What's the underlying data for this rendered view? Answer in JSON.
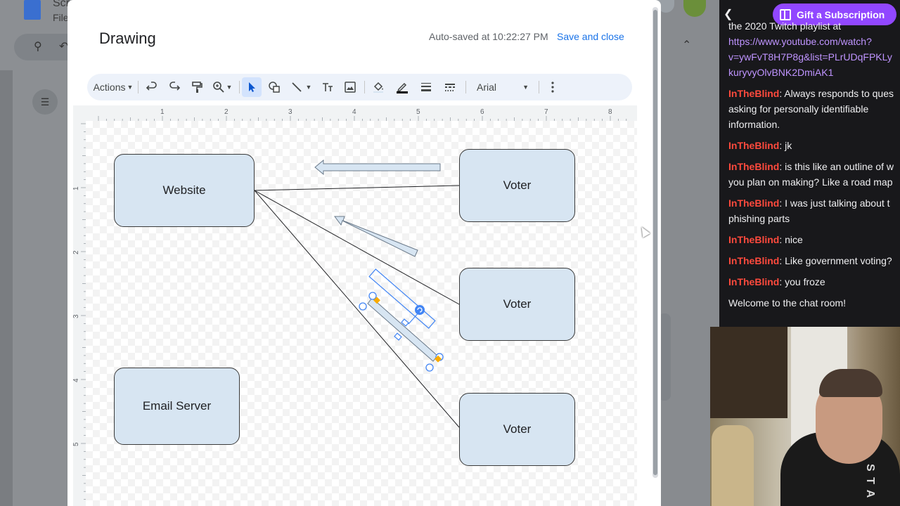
{
  "background_app": {
    "doc_name": "Scr",
    "file_menu": "File"
  },
  "dialog": {
    "title": "Drawing",
    "autosave": "Auto-saved at 10:22:27 PM",
    "save_close": "Save and close"
  },
  "toolbar": {
    "actions_label": "Actions",
    "font_name": "Arial",
    "icons": [
      "undo-icon",
      "redo-icon",
      "paint-format-icon",
      "zoom-icon",
      "select-icon",
      "shape-icon",
      "line-icon",
      "text-box-icon",
      "image-icon",
      "fill-color-icon",
      "border-color-icon",
      "border-weight-icon",
      "border-dash-icon",
      "more-icon"
    ]
  },
  "ruler": {
    "top": [
      "1",
      "2",
      "3",
      "4",
      "5",
      "6",
      "7",
      "8"
    ],
    "left": [
      "1",
      "2",
      "3",
      "4",
      "5"
    ]
  },
  "shapes": {
    "website": "Website",
    "voter1": "Voter",
    "voter2": "Voter",
    "voter3": "Voter",
    "email_server": "Email Server"
  },
  "colors": {
    "box_fill": "#d7e5f2",
    "accent": "#1a73e8",
    "chat_user": "#ff4a3d",
    "twitch_purple": "#9147ff"
  },
  "chat": {
    "gift_button": "Gift a Subscription",
    "partial_top": "the 2020 Twitch playlist at",
    "link": "https://www.youtube.com/watch?v=ywFvT8H7P8g&list=PLrUDqFPKLykuryvyOlvBNK2DmiAK1",
    "link_line1": "https://www.youtube.com/watch?",
    "link_line2": "v=ywFvT8H7P8g&list=PLrUDqFPKLy",
    "link_line3": "kuryvyOlvBNK2DmiAK1",
    "messages": [
      {
        "user": "InTheBlind",
        "line1": ": Always responds to ques",
        "line2": "asking for personally identifiable",
        "line3": "information."
      },
      {
        "user": "InTheBlind",
        "line1": ": jk"
      },
      {
        "user": "InTheBlind",
        "line1": ": is this like an outline of w",
        "line2": "you plan on making? Like a road map"
      },
      {
        "user": "InTheBlind",
        "line1": ": I was just talking about t",
        "line2": "phishing parts"
      },
      {
        "user": "InTheBlind",
        "line1": ": nice"
      },
      {
        "user": "InTheBlind",
        "line1": ": Like government voting?"
      },
      {
        "user": "InTheBlind",
        "line1": ": you froze"
      }
    ],
    "welcome": "Welcome to the chat room!"
  },
  "webcam": {
    "shirt_text": "S T A"
  }
}
